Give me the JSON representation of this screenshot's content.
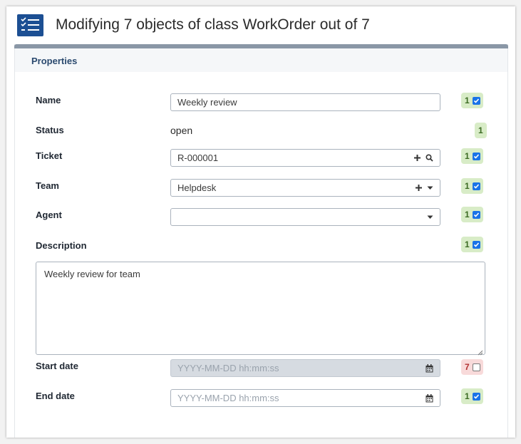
{
  "header": {
    "title": "Modifying 7 objects of class WorkOrder out of 7",
    "icon": "list-checks-icon"
  },
  "panel": {
    "title": "Properties"
  },
  "fields": {
    "name": {
      "label": "Name",
      "value": "Weekly review",
      "count": "1",
      "checked": true
    },
    "status": {
      "label": "Status",
      "value": "open",
      "count": "1"
    },
    "ticket": {
      "label": "Ticket",
      "value": "R-000001",
      "count": "1",
      "checked": true
    },
    "team": {
      "label": "Team",
      "value": "Helpdesk",
      "count": "1",
      "checked": true
    },
    "agent": {
      "label": "Agent",
      "value": "",
      "count": "1",
      "checked": true
    },
    "description": {
      "label": "Description",
      "value": "Weekly review for team",
      "count": "1",
      "checked": true
    },
    "start_date": {
      "label": "Start date",
      "placeholder": "YYYY-MM-DD hh:mm:ss",
      "count": "7",
      "checked": false
    },
    "end_date": {
      "label": "End date",
      "placeholder": "YYYY-MM-DD hh:mm:ss",
      "count": "1",
      "checked": true
    }
  },
  "colors": {
    "brand": "#1c4f93",
    "badge_green": "#d8ecc7",
    "badge_red": "#f8dada",
    "checkbox": "#1a73e8"
  }
}
